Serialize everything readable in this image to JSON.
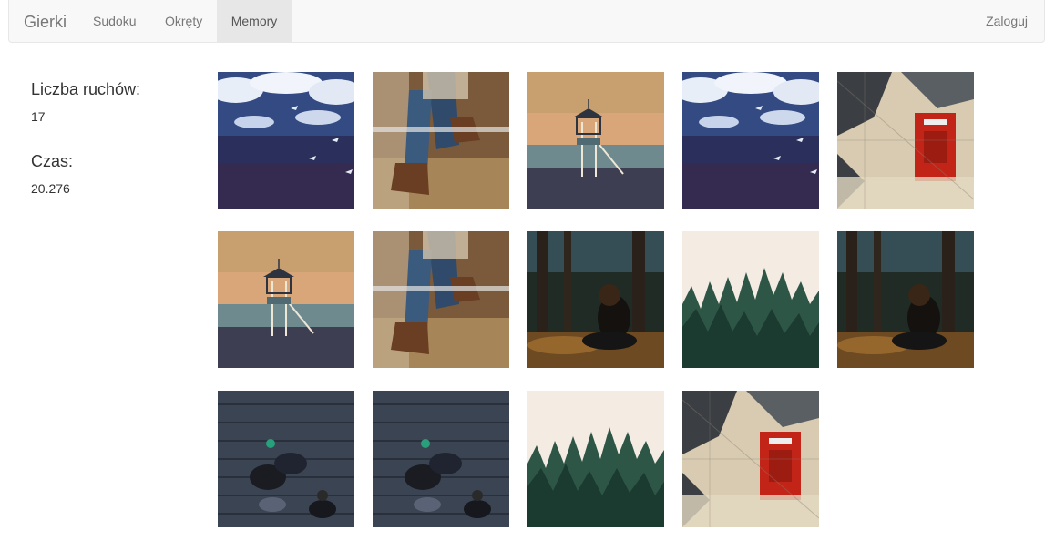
{
  "navbar": {
    "brand": "Gierki",
    "items": [
      {
        "label": "Sudoku",
        "active": false
      },
      {
        "label": "Okręty",
        "active": false
      },
      {
        "label": "Memory",
        "active": true
      }
    ],
    "login": "Zaloguj"
  },
  "stats": {
    "moves_label": "Liczba ruchów:",
    "moves_value": "17",
    "time_label": "Czas:",
    "time_value": "20.276"
  },
  "board": {
    "rows": [
      [
        "water-birds",
        "boots-bench",
        "lifeguard-tower",
        "water-birds",
        "red-mailbox"
      ],
      [
        "lifeguard-tower",
        "boots-bench",
        "woman-forest",
        "misty-forest",
        "woman-forest"
      ],
      [
        "people-boardwalk",
        "people-boardwalk",
        "misty-forest",
        "red-mailbox"
      ]
    ]
  }
}
